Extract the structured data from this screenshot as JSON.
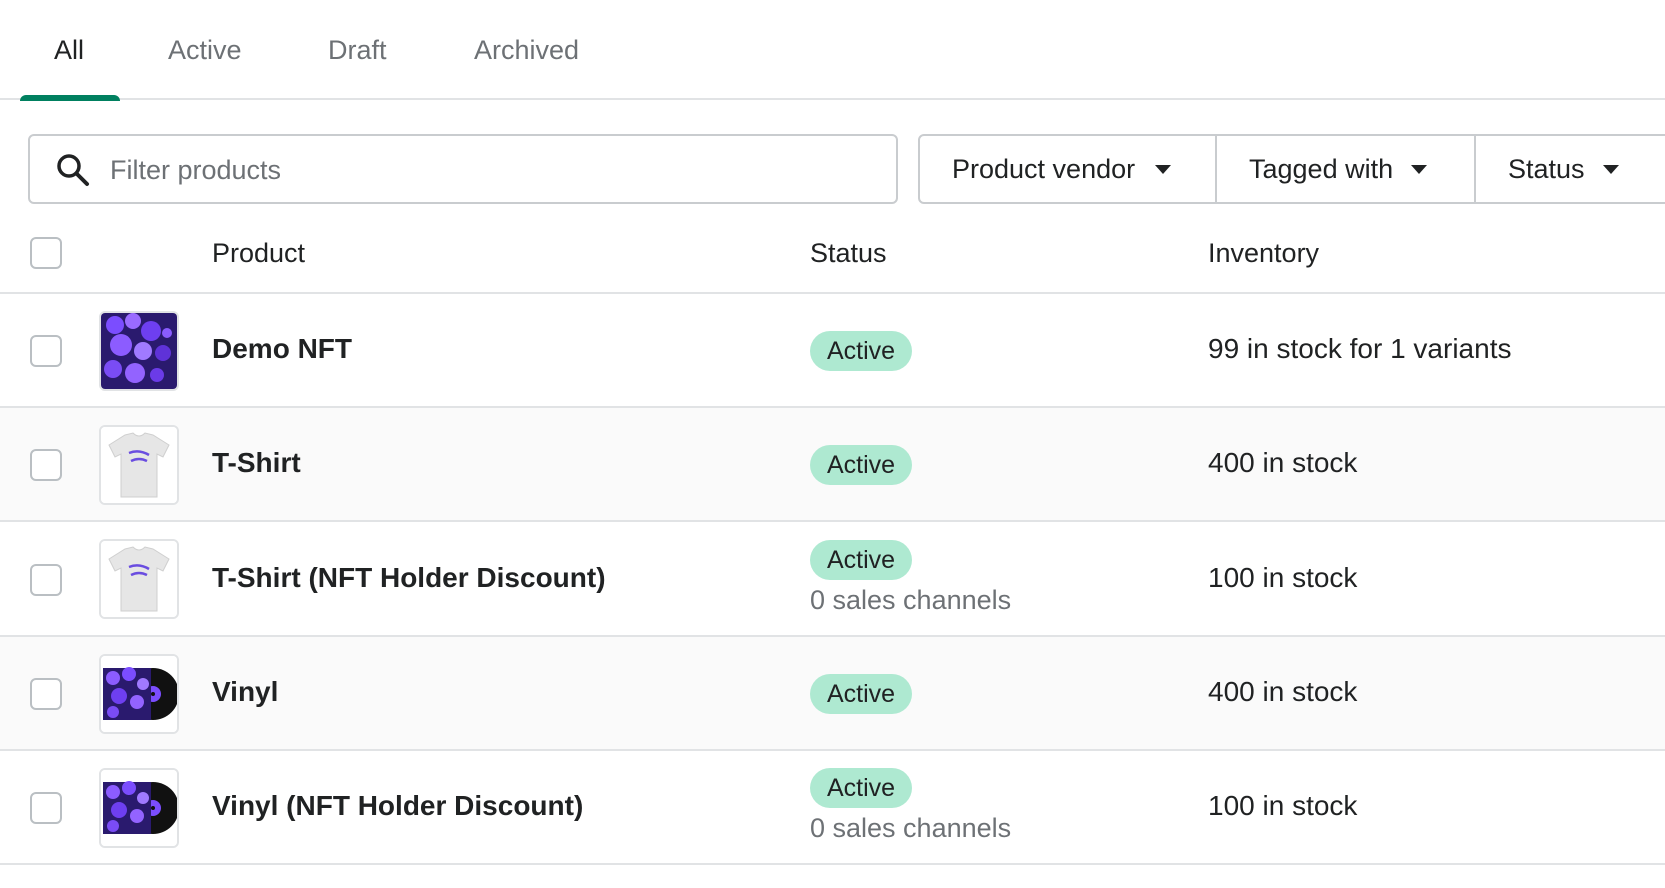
{
  "tabs": [
    {
      "label": "All",
      "selected": true
    },
    {
      "label": "Active",
      "selected": false
    },
    {
      "label": "Draft",
      "selected": false
    },
    {
      "label": "Archived",
      "selected": false
    }
  ],
  "search": {
    "placeholder": "Filter products",
    "value": ""
  },
  "filters": [
    {
      "label": "Product vendor"
    },
    {
      "label": "Tagged with"
    },
    {
      "label": "Status"
    }
  ],
  "table": {
    "headers": {
      "product": "Product",
      "status": "Status",
      "inventory": "Inventory"
    },
    "rows": [
      {
        "name": "Demo NFT",
        "status": "Active",
        "channels": "",
        "inventory": "99 in stock for 1 variants",
        "thumbnail": "nft-art-icon"
      },
      {
        "name": "T-Shirt",
        "status": "Active",
        "channels": "",
        "inventory": "400 in stock",
        "thumbnail": "tshirt-icon"
      },
      {
        "name": "T-Shirt (NFT Holder Discount)",
        "status": "Active",
        "channels": "0 sales channels",
        "inventory": "100 in stock",
        "thumbnail": "tshirt-icon"
      },
      {
        "name": "Vinyl",
        "status": "Active",
        "channels": "",
        "inventory": "400 in stock",
        "thumbnail": "vinyl-record-icon"
      },
      {
        "name": "Vinyl (NFT Holder Discount)",
        "status": "Active",
        "channels": "0 sales channels",
        "inventory": "100 in stock",
        "thumbnail": "vinyl-record-icon"
      }
    ]
  },
  "colors": {
    "accent": "#008060",
    "badge_active": "#aee9d1",
    "border": "#e1e3e5",
    "muted_text": "#6d7175"
  }
}
